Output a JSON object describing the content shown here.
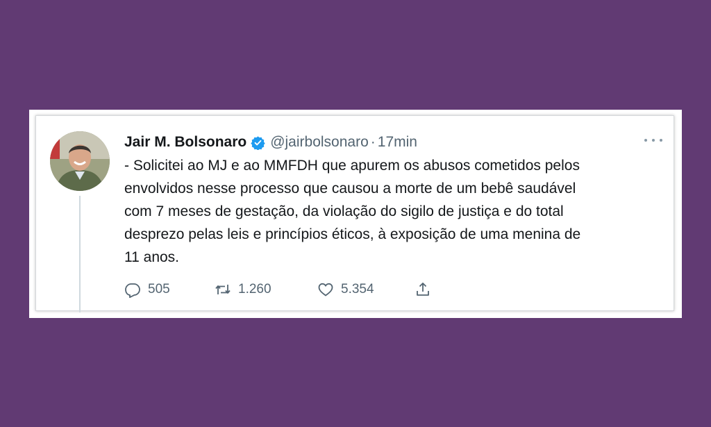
{
  "tweet": {
    "display_name": "Jair M. Bolsonaro",
    "handle": "@jairbolsonaro",
    "separator": "·",
    "time": "17min",
    "text": "- Solicitei ao MJ e ao MMFDH que apurem os abusos cometidos pelos\nenvolvidos nesse processo que causou a morte de um bebê saudável\ncom 7 meses de gestação, da violação do sigilo de justiça e do total\ndesprezo pelas leis e princípios éticos, à exposição de uma menina de\n11 anos.",
    "icons": {
      "verified": "verified-badge-icon",
      "more": "more-icon",
      "reply": "reply-icon",
      "retweet": "retweet-icon",
      "like": "like-icon",
      "share": "share-icon"
    },
    "actions": {
      "reply_count": "505",
      "retweet_count": "1.260",
      "like_count": "5.354"
    }
  },
  "colors": {
    "background": "#613a73",
    "verified": "#1d9bf0",
    "secondary_text": "#536471"
  }
}
